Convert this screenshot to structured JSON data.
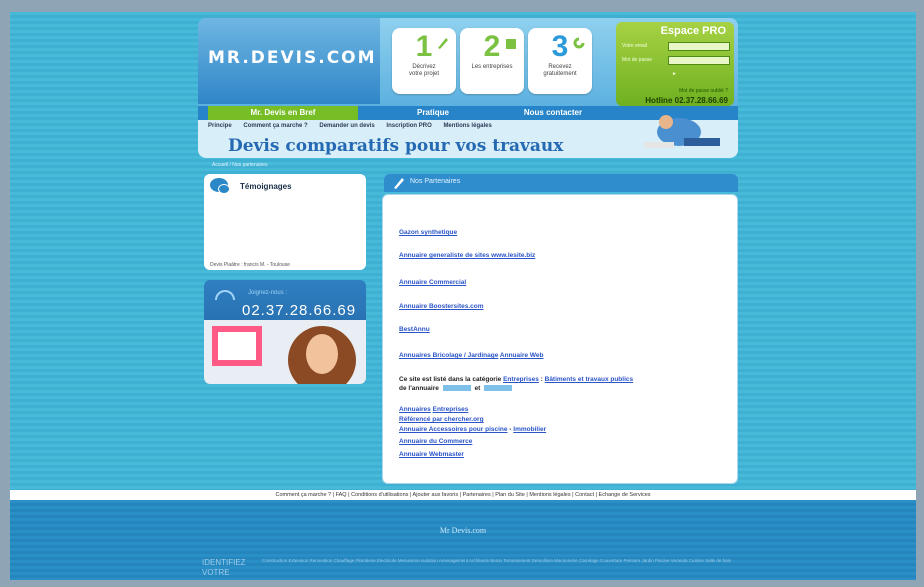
{
  "logo": {
    "text": "MR.DEVIS.COM"
  },
  "steps": [
    {
      "num": "1",
      "line1": "Décrivez",
      "line2": "votre projet"
    },
    {
      "num": "2",
      "line1": "Les entreprises",
      "line2": ""
    },
    {
      "num": "3",
      "line1": "Recevez",
      "line2": "gratuitement"
    }
  ],
  "pro": {
    "title": "Espace PRO",
    "login_label": "Votre email",
    "password_label": "Mot de passe",
    "forgot": "Mot de passe oublié ?",
    "hotline": "Hotline 02.37.28.66.69"
  },
  "nav": [
    "Mr. Devis en Bref",
    "Pratique",
    "Nous contacter"
  ],
  "subnav": [
    "Principe",
    "Comment ça marche ?",
    "Demander un devis",
    "Inscription PRO",
    "Mentions légales"
  ],
  "tagline": "Devis comparatifs pour vos travaux",
  "breadcrumb": "Accueil / Nos partenaires",
  "testimonials": {
    "title": "Témoignages",
    "footer": "Devis Plaâtre : francis M. - Toulouse"
  },
  "contact": {
    "label": "Joignez-nous :",
    "phone": "02.37.28.66.69"
  },
  "partners": {
    "title": "Nos Partenaires",
    "links_top": [
      "Gazon synthetique",
      "Annuaire generaliste de sites www.lesite.biz",
      "Annuaire Commercial",
      "Annuaire Boostersites.com",
      "BestAnnu"
    ],
    "bricolage": "Annuaires Bricolage / Jardinage",
    "annuaire_web": "Annuaire Web",
    "listed_text": "Ce site est listé dans la catégorie",
    "cat1": "Entreprises",
    "cat2": "Bâtiments et travaux publics",
    "cat_tail": "de l'annuaire",
    "and": "et",
    "annuaires": "Annuaires",
    "entreprises": "Entreprises",
    "reference": "Référencé par chercher.org",
    "piscine": "Annuaire Accessoires pour piscine",
    "immobilier": "Immobilier",
    "commerce": "Annuaire du Commerce",
    "webmaster": "Annuaire Webmaster"
  },
  "footer": {
    "links": "Comment ça marche ?  |  FAQ  |  Conditions d'utilisations  |  Ajouter aux favoris  |  Partenaires  |  Plan du Site  |  Mentions légales  |  Contact  |  Echange de Services",
    "site": "Mr Devis.com",
    "left1": "IDENTIFIEZ",
    "left2": "VOTRE",
    "cols": "Construction  Extension  Renovation  Chauffage  Plomberie  Electricite  Menuiserie  Isolation  Amenagement  Architecte  Beton  Terrassement  Demolition  Maconnerie  Carrelage  Couverture  Peinture  Jardin  Piscine  Veranda  Cuisine  Salle de bain"
  },
  "colors": {
    "accent_green": "#77bd25",
    "accent_blue": "#2784c9",
    "bg_cyan": "#47b9d9"
  }
}
